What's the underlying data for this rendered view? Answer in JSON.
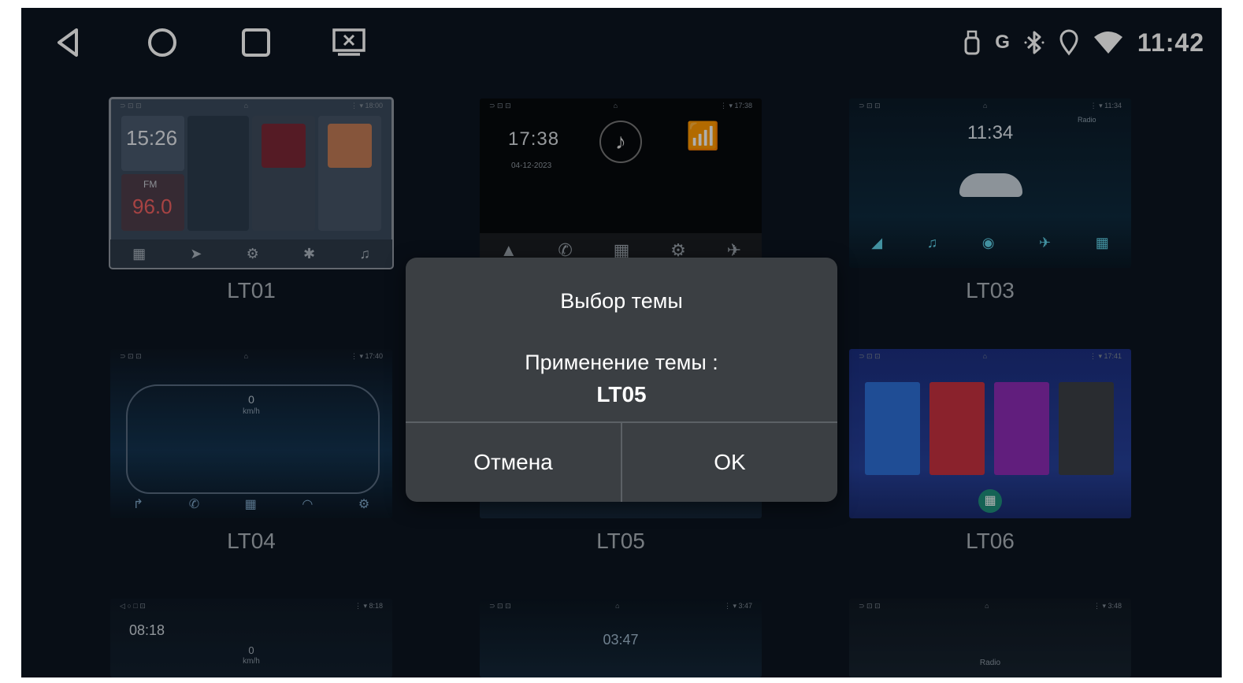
{
  "status_bar": {
    "time": "11:42",
    "icons": [
      "usb-icon",
      "g-icon",
      "bluetooth-icon",
      "location-icon",
      "wifi-icon"
    ],
    "g_label": "G"
  },
  "nav_buttons": [
    "back-icon",
    "home-icon",
    "recents-icon",
    "screen-off-icon"
  ],
  "themes": [
    {
      "id": "LT01",
      "label": "LT01",
      "selected": true,
      "preview_time": "15:26",
      "preview_radio": "96.0",
      "preview_radio_band": "FM"
    },
    {
      "id": "LT02",
      "label": "",
      "selected": false,
      "preview_time": "17:38",
      "preview_date": "04-12-2023"
    },
    {
      "id": "LT03",
      "label": "LT03",
      "selected": false,
      "preview_time": "11:34",
      "preview_radio": "Radio"
    },
    {
      "id": "LT04",
      "label": "LT04",
      "selected": false,
      "preview_speed": "0",
      "preview_unit": "km/h"
    },
    {
      "id": "LT05",
      "label": "LT05",
      "selected": false
    },
    {
      "id": "LT06",
      "label": "LT06",
      "selected": false
    },
    {
      "id": "LT07",
      "label": "",
      "selected": false,
      "preview_time": "08:18",
      "preview_speed": "0",
      "preview_unit": "km/h"
    },
    {
      "id": "LT08",
      "label": "",
      "selected": false,
      "preview_time": "03:47"
    },
    {
      "id": "LT09",
      "label": "",
      "selected": false,
      "preview_radio": "Radio"
    }
  ],
  "dialog": {
    "title": "Выбор темы",
    "message": "Применение темы :",
    "theme_name": "LT05",
    "cancel_label": "Отмена",
    "ok_label": "OK"
  },
  "colors": {
    "background": "#0c1520",
    "dialog": "#3b3f43",
    "label": "#a9b0b8"
  }
}
